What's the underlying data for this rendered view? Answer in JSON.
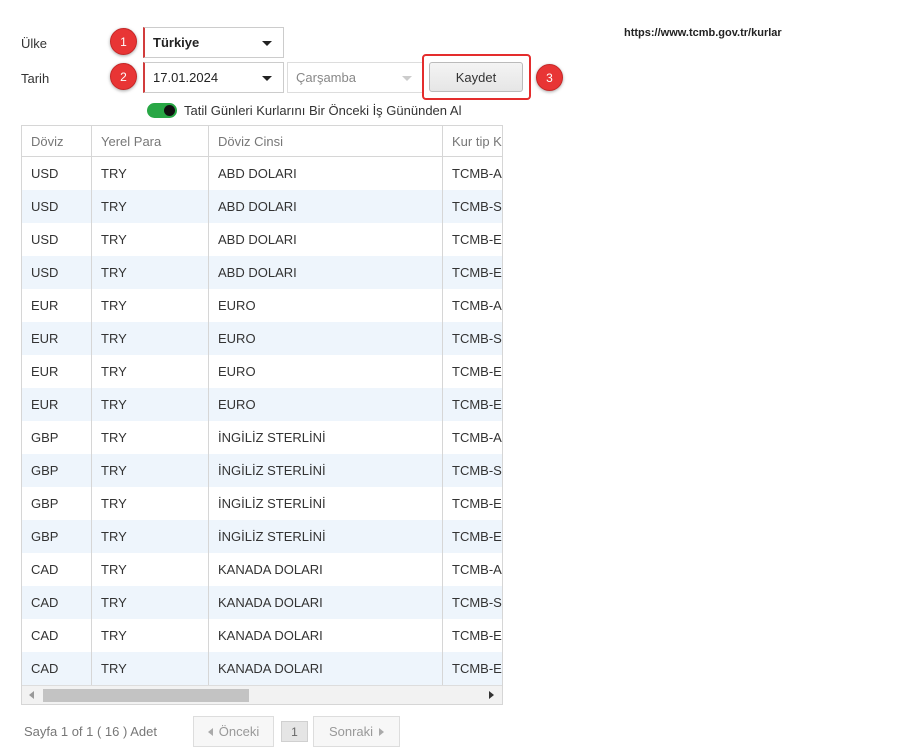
{
  "form": {
    "country_label": "Ülke",
    "country_value": "Türkiye",
    "date_label": "Tarih",
    "date_value": "17.01.2024",
    "weekday_value": "Çarşamba",
    "save_label": "Kaydet",
    "toggle_label": "Tatil Günleri Kurlarını Bir Önceki İş Gününden Al",
    "toggle_on": true
  },
  "source_url": "https://www.tcmb.gov.tr/kurlar",
  "badges": [
    "1",
    "2",
    "3"
  ],
  "colors": {
    "badge": "#e83535",
    "toggle": "#28a745",
    "alt_row": "#eef5fc",
    "highlight": "#e42d2d"
  },
  "grid": {
    "columns": [
      "Döviz",
      "Yerel Para",
      "Döviz Cinsi",
      "Kur tip K"
    ],
    "rows": [
      [
        "USD",
        "TRY",
        "ABD DOLARI",
        "TCMB-AL"
      ],
      [
        "USD",
        "TRY",
        "ABD DOLARI",
        "TCMB-SA"
      ],
      [
        "USD",
        "TRY",
        "ABD DOLARI",
        "TCMB-ES"
      ],
      [
        "USD",
        "TRY",
        "ABD DOLARI",
        "TCMB-EA"
      ],
      [
        "EUR",
        "TRY",
        "EURO",
        "TCMB-AL"
      ],
      [
        "EUR",
        "TRY",
        "EURO",
        "TCMB-SA"
      ],
      [
        "EUR",
        "TRY",
        "EURO",
        "TCMB-ES"
      ],
      [
        "EUR",
        "TRY",
        "EURO",
        "TCMB-EA"
      ],
      [
        "GBP",
        "TRY",
        "İNGİLİZ STERLİNİ",
        "TCMB-AL"
      ],
      [
        "GBP",
        "TRY",
        "İNGİLİZ STERLİNİ",
        "TCMB-SA"
      ],
      [
        "GBP",
        "TRY",
        "İNGİLİZ STERLİNİ",
        "TCMB-ES"
      ],
      [
        "GBP",
        "TRY",
        "İNGİLİZ STERLİNİ",
        "TCMB-EA"
      ],
      [
        "CAD",
        "TRY",
        "KANADA DOLARI",
        "TCMB-AL"
      ],
      [
        "CAD",
        "TRY",
        "KANADA DOLARI",
        "TCMB-SA"
      ],
      [
        "CAD",
        "TRY",
        "KANADA DOLARI",
        "TCMB-ES"
      ],
      [
        "CAD",
        "TRY",
        "KANADA DOLARI",
        "TCMB-EA"
      ]
    ]
  },
  "pager": {
    "info": "Sayfa 1 of 1 ( 16 ) Adet",
    "prev_label": "Önceki",
    "page": "1",
    "next_label": "Sonraki"
  }
}
